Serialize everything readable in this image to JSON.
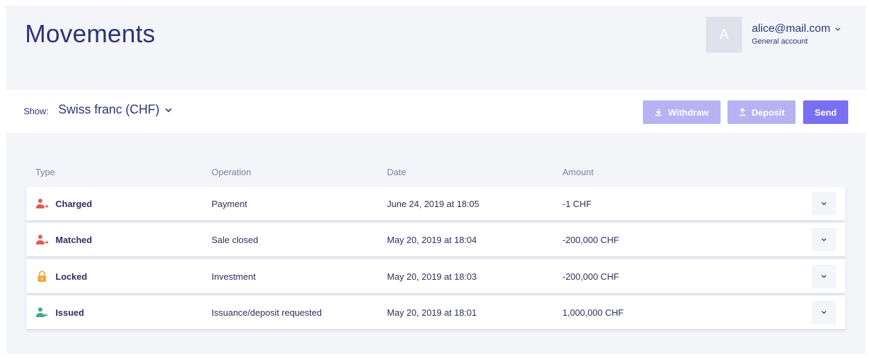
{
  "header": {
    "title": "Movements"
  },
  "account": {
    "avatar_initial": "A",
    "email": "alice@mail.com",
    "type": "General account"
  },
  "toolbar": {
    "show_label": "Show:",
    "currency": "Swiss franc (CHF)",
    "withdraw_label": "Withdraw",
    "deposit_label": "Deposit",
    "send_label": "Send"
  },
  "table": {
    "columns": [
      "Type",
      "Operation",
      "Date",
      "Amount"
    ],
    "rows": [
      {
        "type": "Charged",
        "icon": "user-outgoing-icon",
        "operation": "Payment",
        "date": "June 24, 2019 at 18:05",
        "amount": "-1 CHF"
      },
      {
        "type": "Matched",
        "icon": "user-outgoing-icon",
        "operation": "Sale closed",
        "date": "May 20, 2019 at 18:04",
        "amount": "-200,000 CHF"
      },
      {
        "type": "Locked",
        "icon": "lock-icon",
        "operation": "Investment",
        "date": "May 20, 2019 at 18:03",
        "amount": "-200,000 CHF"
      },
      {
        "type": "Issued",
        "icon": "user-incoming-icon",
        "operation": "Issuance/deposit requested",
        "date": "May 20, 2019 at 18:01",
        "amount": "1,000,000 CHF"
      }
    ]
  },
  "colors": {
    "accent": "#7a6ff0",
    "accent_disabled": "#b8b2f3",
    "outgoing": "#e05a55",
    "locked": "#f2a93b",
    "incoming": "#3fa88a",
    "title": "#2f3477"
  }
}
